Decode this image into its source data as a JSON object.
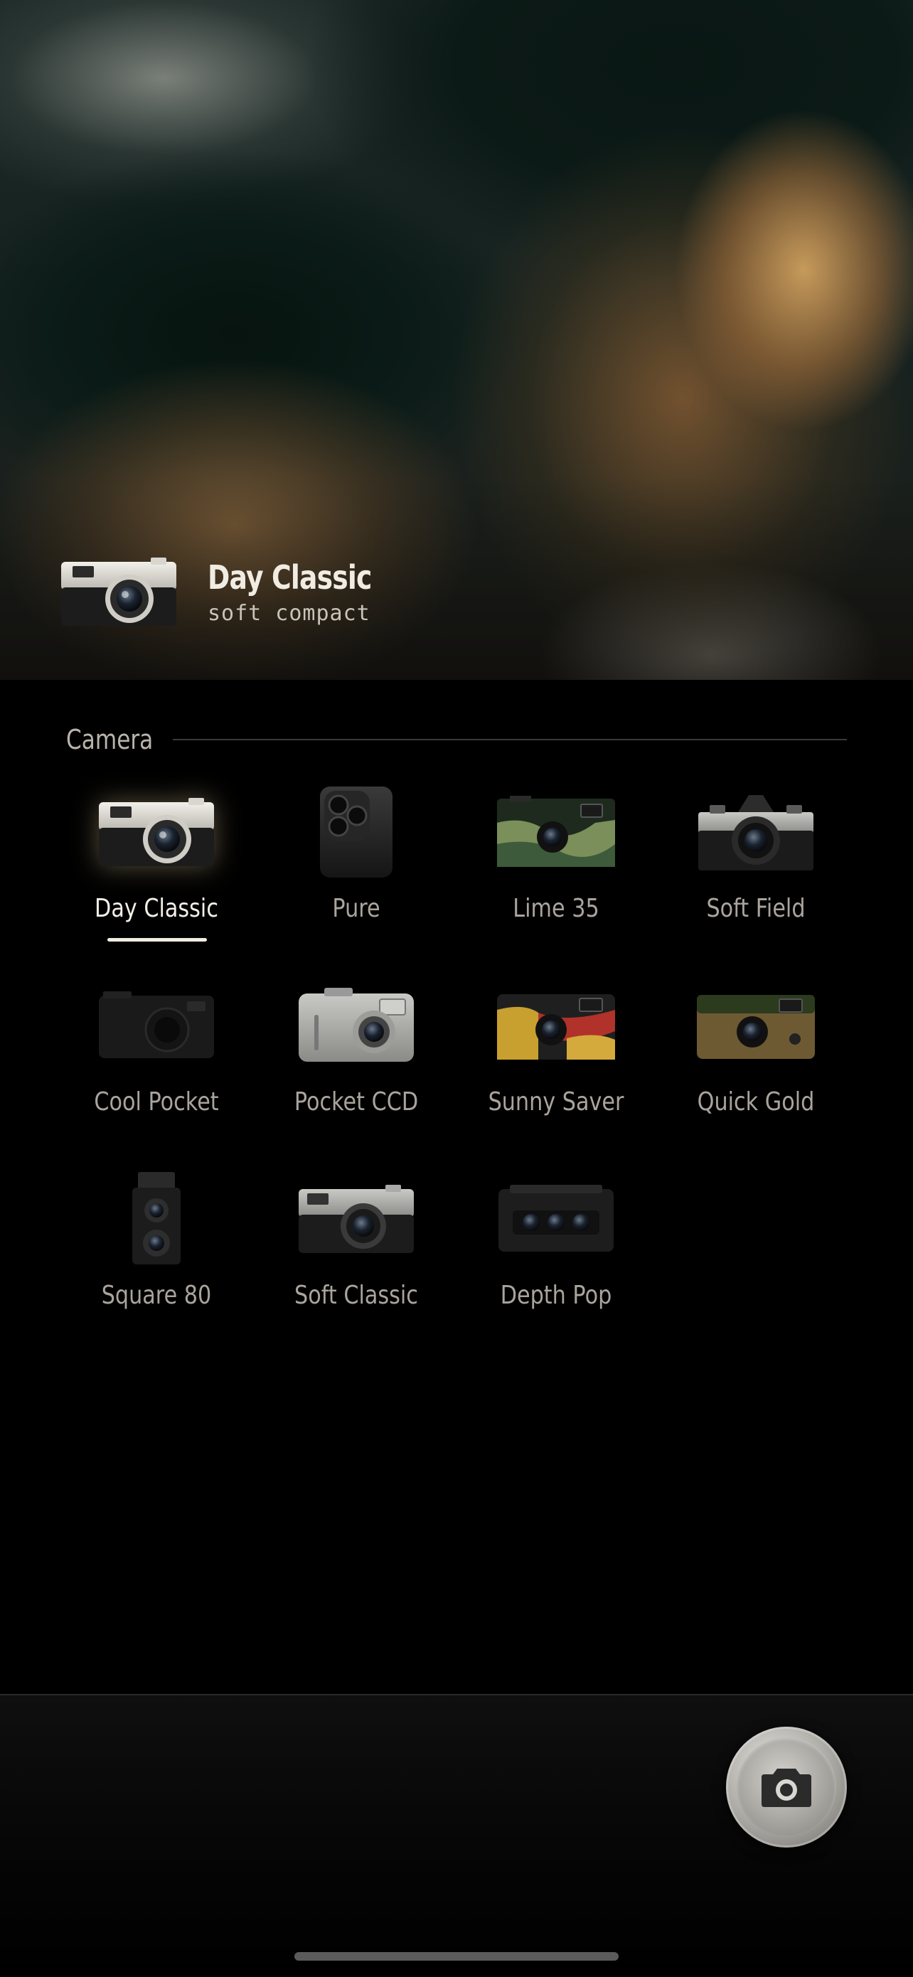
{
  "current_camera": {
    "name": "Day Classic",
    "subtitle": "soft compact",
    "icon": "silver-rangefinder-camera-icon"
  },
  "section": {
    "label": "Camera"
  },
  "cameras": [
    {
      "name": "Day Classic",
      "icon": "silver-rangefinder-camera-icon",
      "selected": true
    },
    {
      "name": "Pure",
      "icon": "smartphone-triple-lens-icon",
      "selected": false
    },
    {
      "name": "Lime 35",
      "icon": "green-disposable-camera-icon",
      "selected": false
    },
    {
      "name": "Soft Field",
      "icon": "slr-camera-icon",
      "selected": false
    },
    {
      "name": "Cool Pocket",
      "icon": "black-compact-camera-icon",
      "selected": false
    },
    {
      "name": "Pocket CCD",
      "icon": "silver-digital-compact-icon",
      "selected": false
    },
    {
      "name": "Sunny Saver",
      "icon": "yellow-disposable-camera-icon",
      "selected": false
    },
    {
      "name": "Quick Gold",
      "icon": "gold-disposable-camera-icon",
      "selected": false
    },
    {
      "name": "Square 80",
      "icon": "twin-lens-reflex-camera-icon",
      "selected": false
    },
    {
      "name": "Soft Classic",
      "icon": "black-rangefinder-camera-icon",
      "selected": false
    },
    {
      "name": "Depth Pop",
      "icon": "three-lens-3d-camera-icon",
      "selected": false
    }
  ],
  "shutter": {
    "icon": "camera-icon"
  },
  "colors": {
    "background": "#000000",
    "selected_label": "#f3efe7",
    "label": "#a9a49c"
  }
}
